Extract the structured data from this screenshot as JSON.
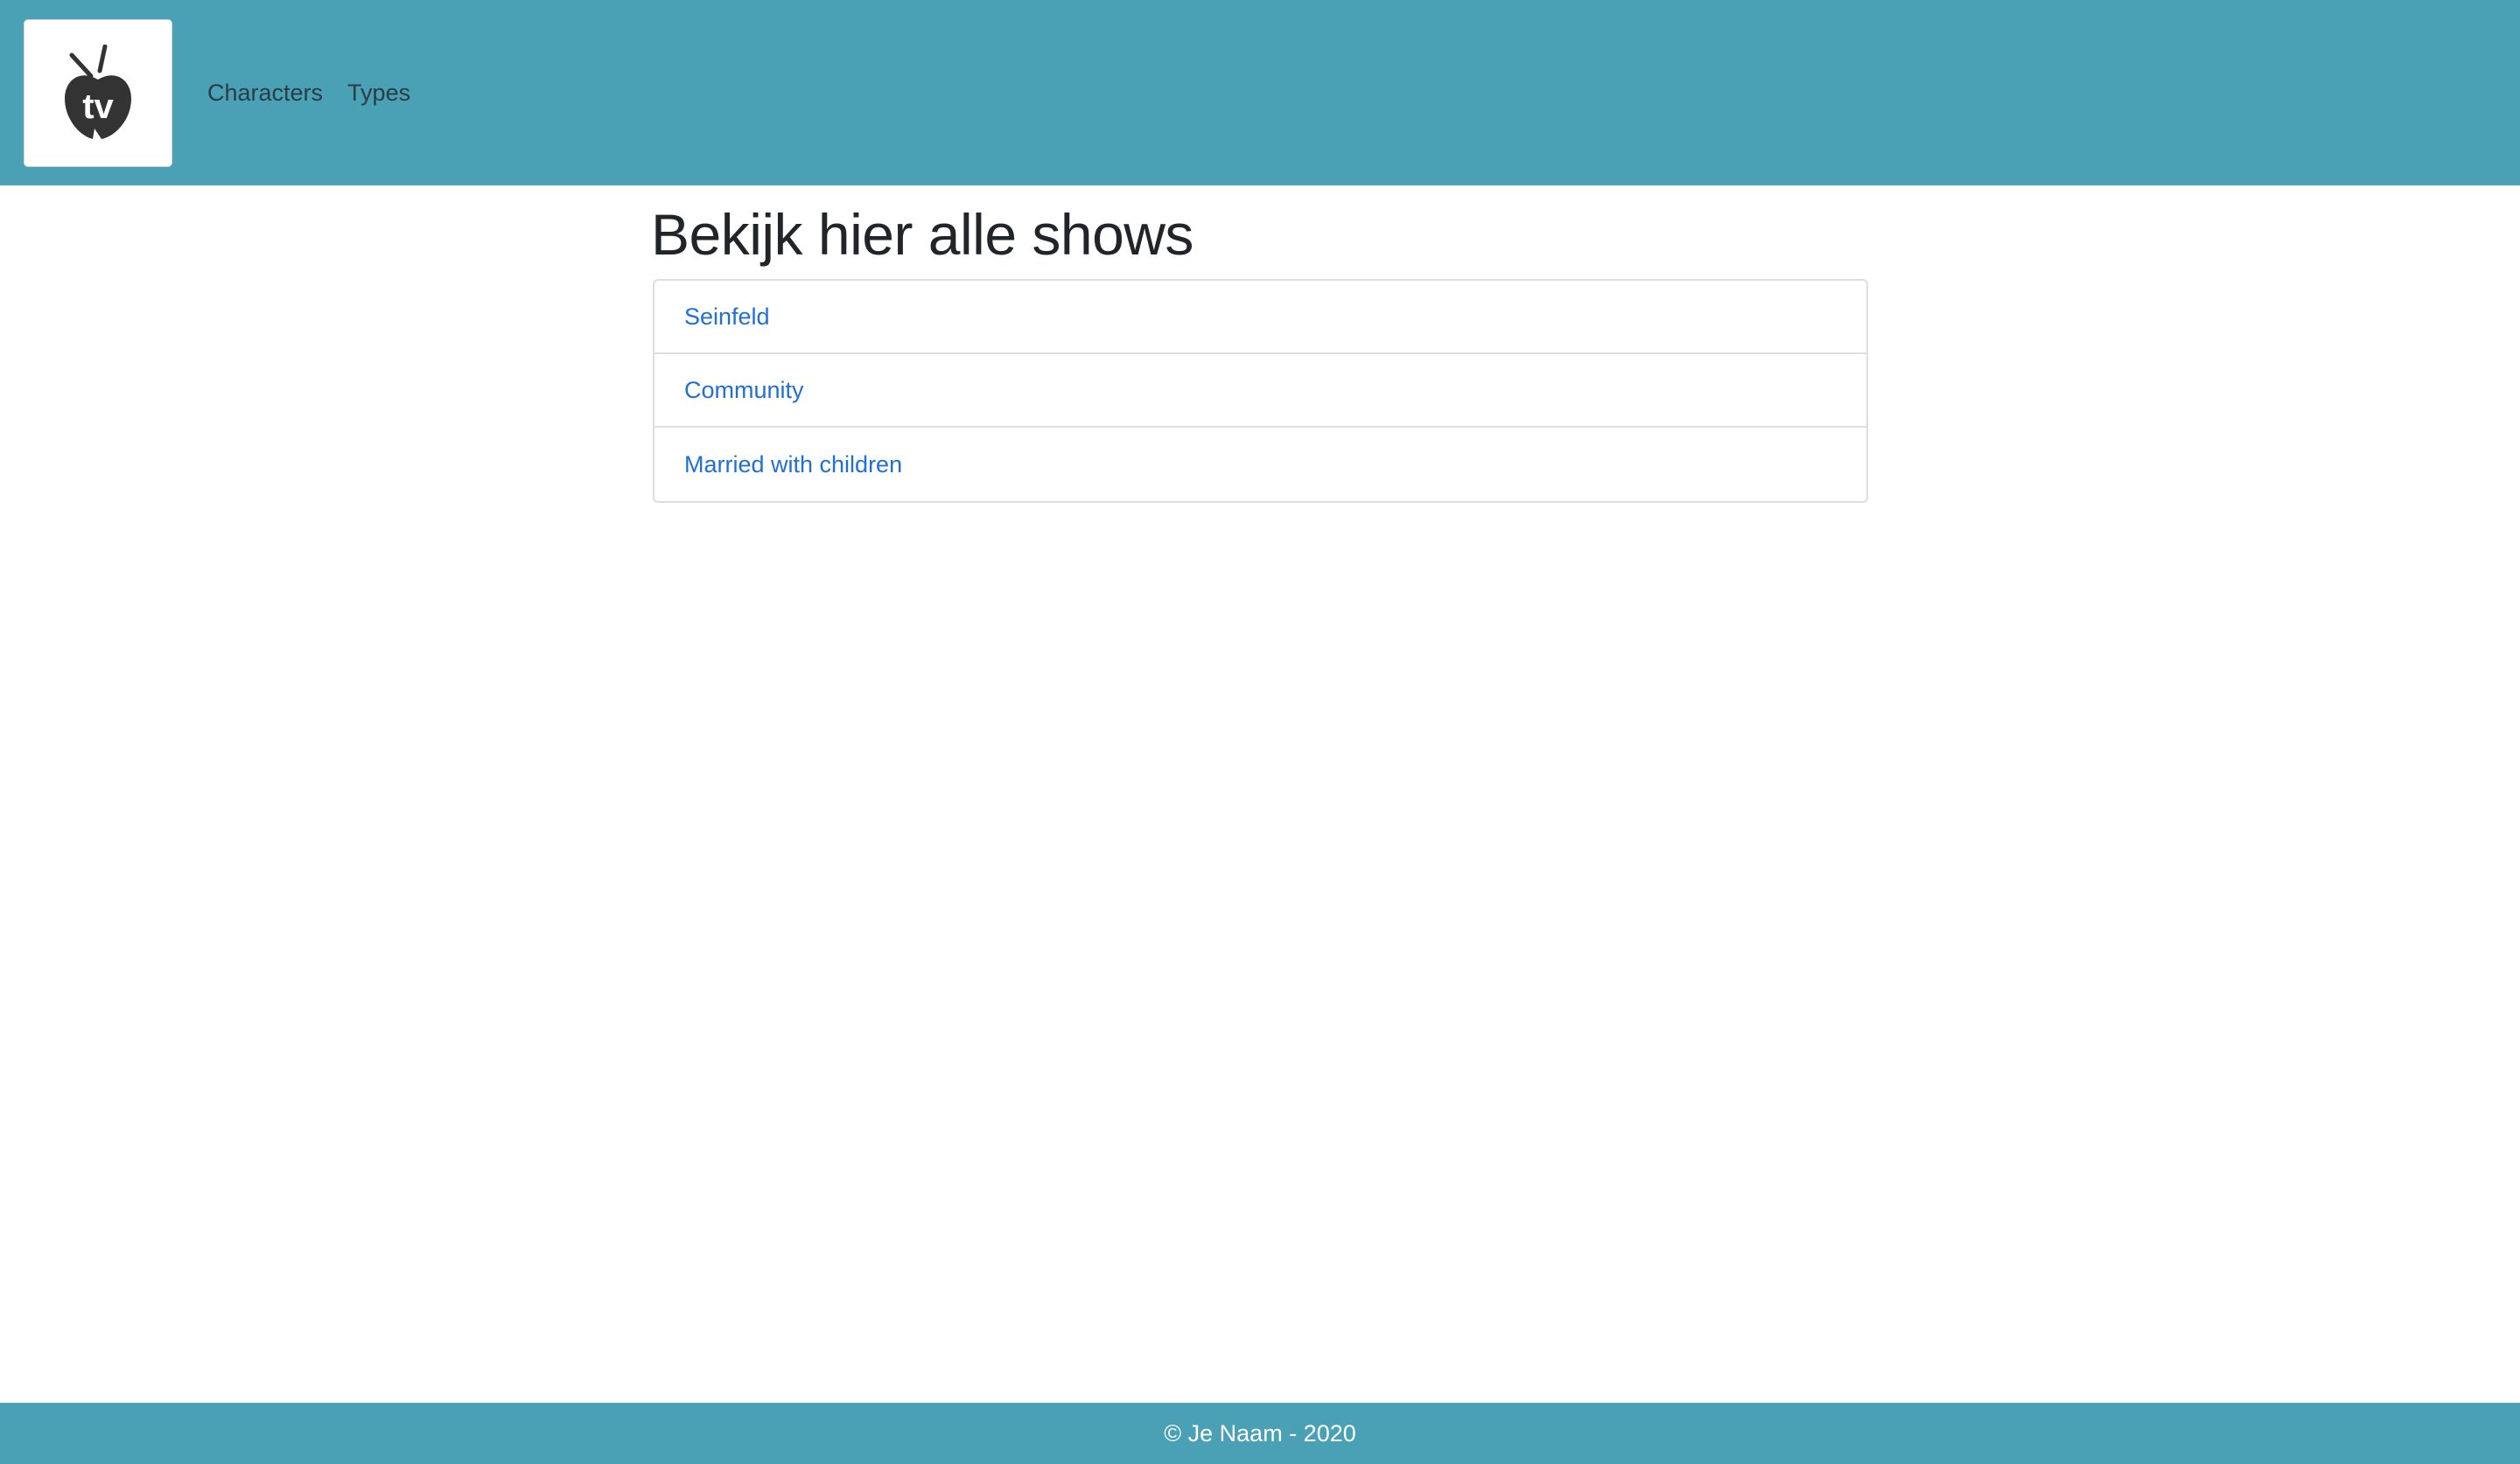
{
  "header": {
    "logo_text": "tv",
    "logo_icon": "tv-apple-logo-icon",
    "nav": [
      {
        "label": "Characters"
      },
      {
        "label": "Types"
      }
    ]
  },
  "main": {
    "title": "Bekijk hier alle shows",
    "shows": [
      {
        "label": "Seinfeld"
      },
      {
        "label": "Community"
      },
      {
        "label": "Married with children"
      }
    ]
  },
  "footer": {
    "text": "© Je Naam - 2020"
  },
  "colors": {
    "header_bg": "#4aa1b6",
    "link": "#1f6fd6",
    "footer_bg": "#4aa1b6"
  }
}
